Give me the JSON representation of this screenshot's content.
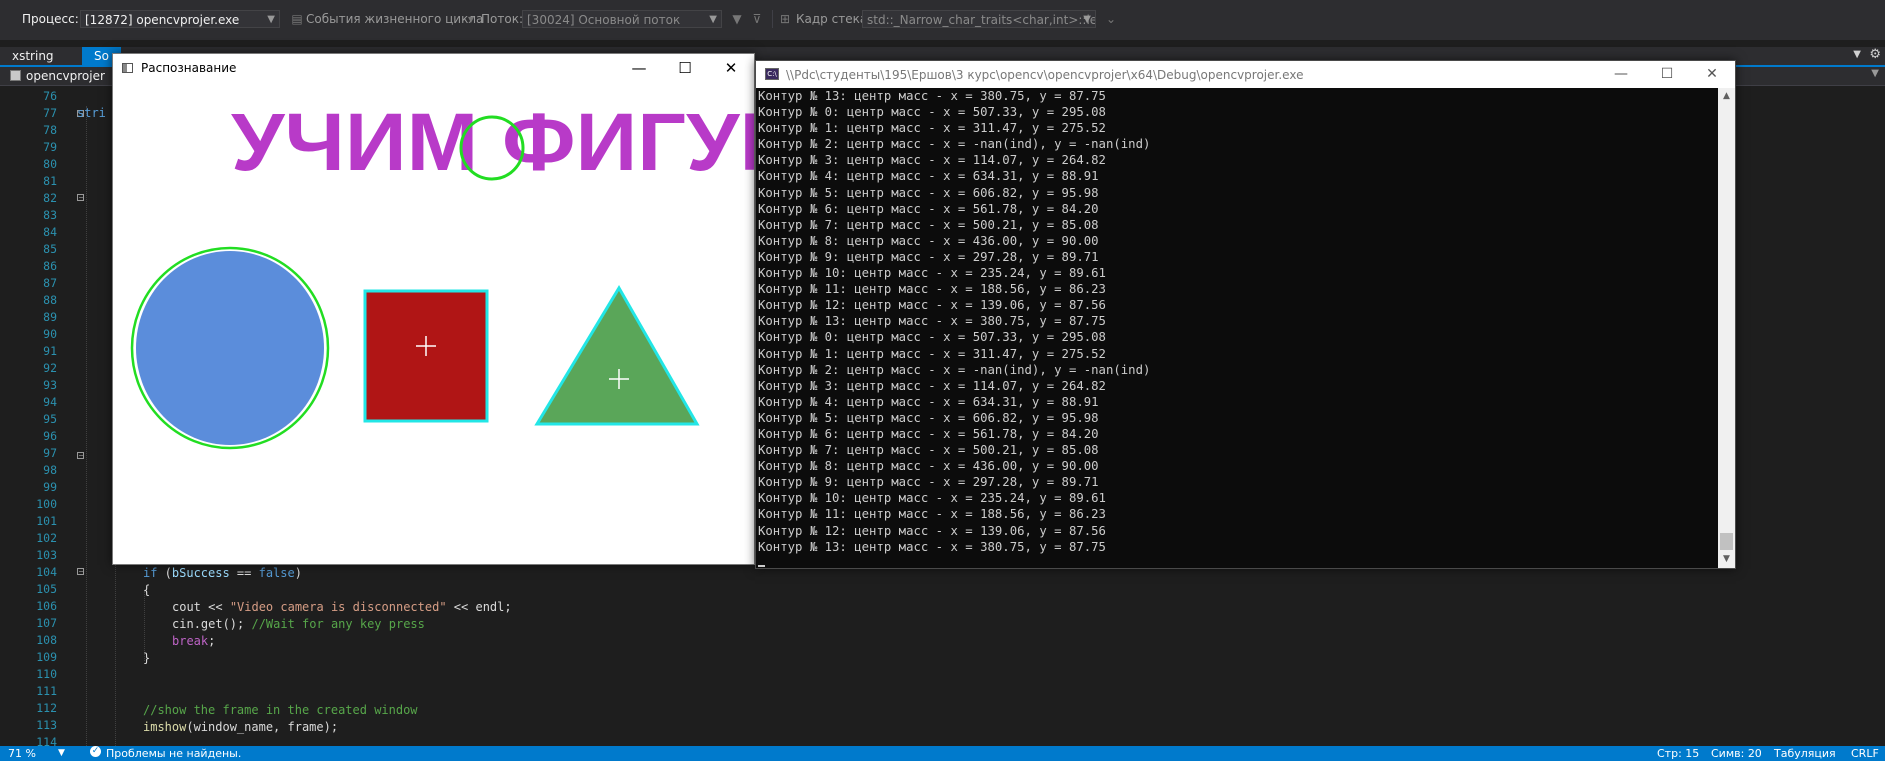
{
  "debug_toolbar": {
    "process_label": "Процесс:",
    "process_value": "[12872] opencvprojer.exe",
    "lifecycle_label": "События жизненного цикла",
    "thread_label": "Поток:",
    "thread_value": "[30024] Основной поток",
    "stack_label": "Кадр стека:",
    "stack_value": "std::_Narrow_char_traits<char,int>::length"
  },
  "tabs": [
    {
      "label": "xstring"
    },
    {
      "label": "So"
    }
  ],
  "navbar": {
    "project": "opencvprojer"
  },
  "editor": {
    "line_numbers": [
      "76",
      "77",
      "78",
      "79",
      "80",
      "81",
      "82",
      "83",
      "84",
      "85",
      "86",
      "87",
      "88",
      "89",
      "90",
      "91",
      "92",
      "93",
      "94",
      "95",
      "96",
      "97",
      "98",
      "99",
      "100",
      "101",
      "102",
      "103",
      "104",
      "105",
      "106",
      "107",
      "108",
      "109",
      "110",
      "111",
      "112",
      "113",
      "114"
    ],
    "line77_fragment": "stri",
    "line104": {
      "kw_if": "if",
      "paren_open": " (",
      "var": "bSuccess",
      "op": " == ",
      "kw_false": "false",
      "paren_close": ")"
    },
    "line105": "{",
    "line106": {
      "ident": "cout",
      "op1": " << ",
      "string": "\"Video camera is disconnected\"",
      "op2": " << ",
      "endl": "endl",
      "semi": ";"
    },
    "line107": {
      "ident": "cin",
      "call": ".get(); ",
      "comment": "//Wait for any key press"
    },
    "line108": {
      "kw": "break",
      "semi": ";"
    },
    "line109": "}",
    "line112": "//show the frame in the created window",
    "line113": {
      "fn": "imshow",
      "args": "(window_name, frame);"
    }
  },
  "cv_window": {
    "title": "Распознавание",
    "image_text": "УЧИМ ФИГУРЫ"
  },
  "console_window": {
    "title": "\\\\Pdc\\студенты\\195\\Ершов\\3 курс\\opencv\\opencvprojer\\x64\\Debug\\opencvprojer.exe",
    "lines": [
      "Контур № 13: центр масс - x = 380.75, y = 87.75",
      "Контур № 0: центр масс - x = 507.33, y = 295.08",
      "Контур № 1: центр масс - x = 311.47, y = 275.52",
      "Контур № 2: центр масс - x = -nan(ind), y = -nan(ind)",
      "Контур № 3: центр масс - x = 114.07, y = 264.82",
      "Контур № 4: центр масс - x = 634.31, y = 88.91",
      "Контур № 5: центр масс - x = 606.82, y = 95.98",
      "Контур № 6: центр масс - x = 561.78, y = 84.20",
      "Контур № 7: центр масс - x = 500.21, y = 85.08",
      "Контур № 8: центр масс - x = 436.00, y = 90.00",
      "Контур № 9: центр масс - x = 297.28, y = 89.71",
      "Контур № 10: центр масс - x = 235.24, y = 89.61",
      "Контур № 11: центр масс - x = 188.56, y = 86.23",
      "Контур № 12: центр масс - x = 139.06, y = 87.56",
      "Контур № 13: центр масс - x = 380.75, y = 87.75",
      "Контур № 0: центр масс - x = 507.33, y = 295.08",
      "Контур № 1: центр масс - x = 311.47, y = 275.52",
      "Контур № 2: центр масс - x = -nan(ind), y = -nan(ind)",
      "Контур № 3: центр масс - x = 114.07, y = 264.82",
      "Контур № 4: центр масс - x = 634.31, y = 88.91",
      "Контур № 5: центр масс - x = 606.82, y = 95.98",
      "Контур № 6: центр масс - x = 561.78, y = 84.20",
      "Контур № 7: центр масс - x = 500.21, y = 85.08",
      "Контур № 8: центр масс - x = 436.00, y = 90.00",
      "Контур № 9: центр масс - x = 297.28, y = 89.71",
      "Контур № 10: центр масс - x = 235.24, y = 89.61",
      "Контур № 11: центр масс - x = 188.56, y = 86.23",
      "Контур № 12: центр масс - x = 139.06, y = 87.56",
      "Контур № 13: центр масс - x = 380.75, y = 87.75"
    ]
  },
  "statusbar": {
    "zoom": "71 %",
    "problems": "Проблемы не найдены.",
    "line": "Стр: 15",
    "col": "Симв: 20",
    "indent": "Табуляция",
    "eol": "CRLF"
  },
  "colors": {
    "accent": "#007acc",
    "title_purple": "#b83ac8",
    "circle_blue": "#5b8ddb",
    "square_red": "#b01515",
    "triangle_green": "#5aa659",
    "contour_green": "#22dd22",
    "contour_cyan": "#22e6e6"
  }
}
